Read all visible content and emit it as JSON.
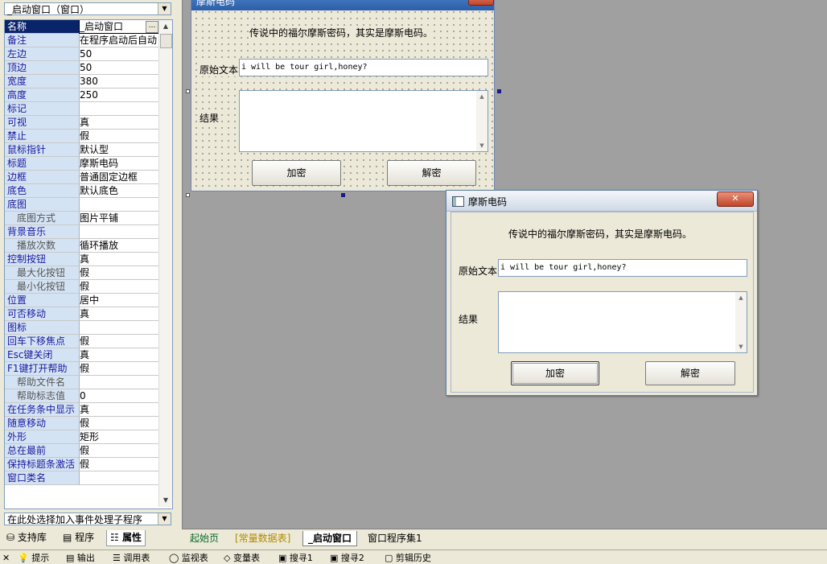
{
  "panel": {
    "object_selector": "_启动窗口（窗口）",
    "rows": [
      {
        "name": "名称",
        "value": "_启动窗口",
        "selected": true
      },
      {
        "name": "备注",
        "value": "在程序启动后自动"
      },
      {
        "name": "左边",
        "value": "50"
      },
      {
        "name": "顶边",
        "value": "50"
      },
      {
        "name": "宽度",
        "value": "380"
      },
      {
        "name": "高度",
        "value": "250"
      },
      {
        "name": "标记",
        "value": ""
      },
      {
        "name": "可视",
        "value": "真"
      },
      {
        "name": "禁止",
        "value": "假"
      },
      {
        "name": "鼠标指针",
        "value": "默认型"
      },
      {
        "name": "标题",
        "value": "摩斯电码"
      },
      {
        "name": "边框",
        "value": "普通固定边框"
      },
      {
        "name": "底色",
        "value": "默认底色"
      },
      {
        "name": "底图",
        "value": ""
      },
      {
        "name": "底图方式",
        "value": "图片平铺",
        "sub": true
      },
      {
        "name": "背景音乐",
        "value": ""
      },
      {
        "name": "播放次数",
        "value": "循环播放",
        "sub": true
      },
      {
        "name": "控制按钮",
        "value": "真"
      },
      {
        "name": "最大化按钮",
        "value": "假",
        "sub": true
      },
      {
        "name": "最小化按钮",
        "value": "假",
        "sub": true
      },
      {
        "name": "位置",
        "value": "居中"
      },
      {
        "name": "可否移动",
        "value": "真"
      },
      {
        "name": "图标",
        "value": ""
      },
      {
        "name": "回车下移焦点",
        "value": "假"
      },
      {
        "name": "Esc键关闭",
        "value": "真"
      },
      {
        "name": "F1键打开帮助",
        "value": "假"
      },
      {
        "name": "帮助文件名",
        "value": "",
        "sub": true
      },
      {
        "name": "帮助标志值",
        "value": "0",
        "sub": true
      },
      {
        "name": "在任务条中显示",
        "value": "真"
      },
      {
        "name": "随意移动",
        "value": "假"
      },
      {
        "name": "外形",
        "value": "矩形"
      },
      {
        "name": "总在最前",
        "value": "假"
      },
      {
        "name": "保持标题条激活",
        "value": "假"
      },
      {
        "name": "窗口类名",
        "value": ""
      }
    ],
    "event_selector": "在此处选择加入事件处理子程序",
    "bottom_tabs": [
      "支持库",
      "程序",
      "属性"
    ]
  },
  "design_form": {
    "title": "摩斯电码",
    "close_glyph": "✕",
    "caption": "传说中的福尔摩斯密码，其实是摩斯电码。",
    "input_label": "原始文本",
    "input_value": "i will be tour girl,honey?",
    "result_label": "结果",
    "encrypt_label": "加密",
    "decrypt_label": "解密"
  },
  "run_window": {
    "title": "摩斯电码",
    "close_glyph": "✕",
    "caption": "传说中的福尔摩斯密码，其实是摩斯电码。",
    "input_label": "原始文本",
    "input_value": "i will be tour girl,honey?",
    "result_label": "结果",
    "encrypt_label": "加密",
    "decrypt_label": "解密"
  },
  "doc_tabs": [
    "起始页",
    "[常量数据表]",
    "_启动窗口",
    "窗口程序集1"
  ],
  "status_items": [
    "✕",
    "提示",
    "输出",
    "调用表",
    "监视表",
    "变量表",
    "搜寻1",
    "搜寻2",
    "剪辑历史"
  ],
  "colors": {
    "selected_row": "#0a246a",
    "name_cell": "#d4e3f3",
    "design_bg": "#a0a0a0",
    "title_bar": "#2d5fa8",
    "const_tab": "#b08a00"
  }
}
